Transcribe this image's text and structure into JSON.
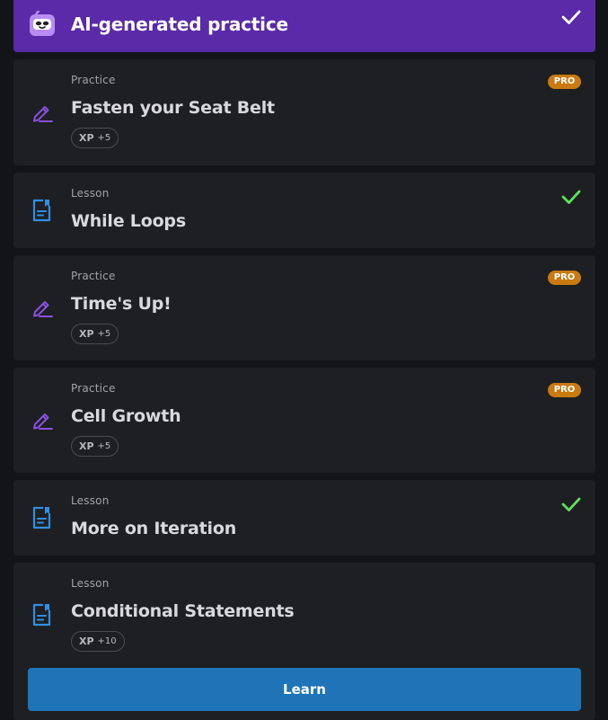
{
  "banner": {
    "title": "AI-generated practice",
    "status_icon": "check-icon",
    "color": "#5a2aa8"
  },
  "items": [
    {
      "kicker": "Practice",
      "title": "Fasten your Seat Belt",
      "icon": "pencil-edit-icon",
      "badge": "PRO",
      "xp_label": "XP",
      "xp_value": "+5",
      "completed": false
    },
    {
      "kicker": "Lesson",
      "title": "While Loops",
      "icon": "document-icon",
      "completed": true
    },
    {
      "kicker": "Practice",
      "title": "Time's Up!",
      "icon": "pencil-edit-icon",
      "badge": "PRO",
      "xp_label": "XP",
      "xp_value": "+5",
      "completed": false
    },
    {
      "kicker": "Practice",
      "title": "Cell Growth",
      "icon": "pencil-edit-icon",
      "badge": "PRO",
      "xp_label": "XP",
      "xp_value": "+5",
      "completed": false
    },
    {
      "kicker": "Lesson",
      "title": "More on Iteration",
      "icon": "document-icon",
      "completed": true
    },
    {
      "kicker": "Lesson",
      "title": "Conditional Statements",
      "icon": "document-icon",
      "xp_label": "XP",
      "xp_value": "+10",
      "completed": false
    }
  ],
  "learn_button": {
    "label": "Learn"
  },
  "colors": {
    "practice_icon": "#8a4fe0",
    "lesson_icon": "#2f8fe6",
    "pro_badge": "#c97a10",
    "check": "#5ee05a",
    "learn": "#1f74b8"
  }
}
